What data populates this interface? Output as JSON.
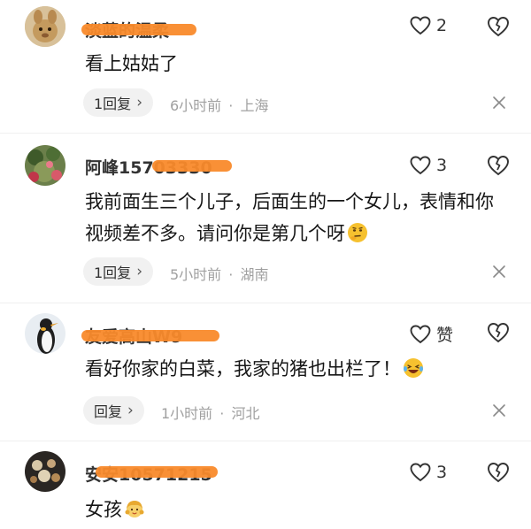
{
  "comments": [
    {
      "username": "淡蓝的温柔",
      "likes": "2",
      "text": "看上姑姑了",
      "reply_label": "1回复",
      "time": "6小时前",
      "location": "上海"
    },
    {
      "username": "阿峰15703330",
      "likes": "3",
      "text": "我前面生三个儿子，后面生的一个女儿，表情和你视频差不多。请问你是第几个呀",
      "reply_label": "1回复",
      "time": "5小时前",
      "location": "湖南"
    },
    {
      "username": "友爱高山W9",
      "likes": "赞",
      "text": "看好你家的白菜，我家的猪也出栏了！",
      "reply_label": "回复",
      "time": "1小时前",
      "location": "河北"
    },
    {
      "username": "安安10571215",
      "likes": "3",
      "text": "女孩",
      "reply_label": "",
      "time": "",
      "location": ""
    }
  ],
  "ui": {
    "meta_separator": "·",
    "chevron": "›"
  },
  "colors": {
    "redaction": "#f98a2b",
    "meta_text": "#a0a0a0",
    "pill_bg": "#f1f1f1"
  },
  "icons": {
    "like": "heart-outline-icon",
    "dislike": "broken-heart-icon",
    "close": "close-icon"
  }
}
